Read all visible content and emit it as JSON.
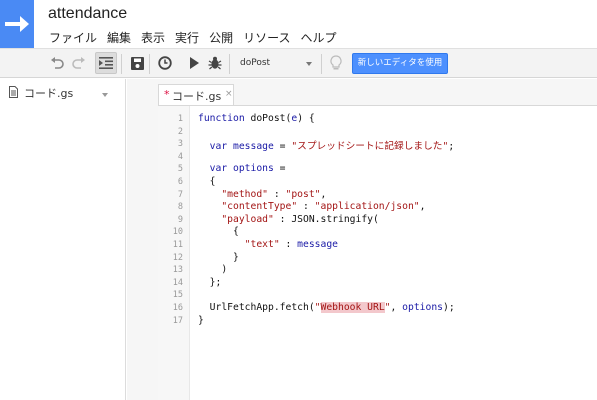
{
  "app": {
    "title": "attendance"
  },
  "menu": [
    "ファイル",
    "編集",
    "表示",
    "実行",
    "公開",
    "リソース",
    "ヘルプ"
  ],
  "toolbar": {
    "function_select": "doPost",
    "new_editor_label": "新しいエディタを使用"
  },
  "files": [
    {
      "name": "コード.gs"
    }
  ],
  "tab": {
    "label": "コード.gs",
    "modified": "*",
    "close": "×"
  },
  "editor": {
    "line_numbers": [
      "1",
      "2",
      "3",
      "4",
      "5",
      "6",
      "7",
      "8",
      "9",
      "10",
      "11",
      "12",
      "13",
      "14",
      "15",
      "16",
      "17"
    ],
    "l1": {
      "a": "function",
      "b": " doPost(",
      "c": "e",
      "d": ") {"
    },
    "l3": {
      "a": "  var",
      "b": " message",
      "c": " = ",
      "d": "\"スプレッドシートに記録しました\"",
      "e": ";"
    },
    "l5": {
      "a": "  var",
      "b": " options",
      "c": " ="
    },
    "l6": "  {",
    "l7": {
      "a": "    \"method\"",
      "b": " : ",
      "c": "\"post\"",
      "d": ","
    },
    "l8": {
      "a": "    \"contentType\"",
      "b": " : ",
      "c": "\"application/json\"",
      "d": ","
    },
    "l9": {
      "a": "    \"payload\"",
      "b": " : JSON.stringify("
    },
    "l10": "      {",
    "l11": {
      "a": "        \"text\"",
      "b": " : ",
      "c": "message"
    },
    "l12": "      }",
    "l13": "    )",
    "l14": "  };",
    "l16": {
      "a": "  UrlFetchApp.fetch(",
      "b": "\"",
      "c": "Webhook URL",
      "d": "\"",
      "e": ", ",
      "f": "options",
      "g": ");"
    },
    "l17": "}"
  },
  "colors": {
    "accent": "#4a8af4",
    "keyword": "#1a1aa6",
    "string": "#a31515",
    "button": "#4d90fe"
  }
}
